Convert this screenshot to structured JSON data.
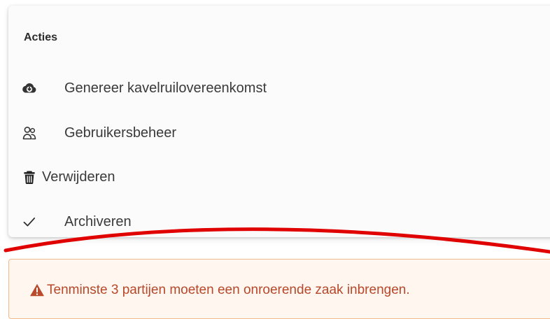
{
  "actions": {
    "title": "Acties",
    "items": [
      {
        "label": "Genereer kavelruilovereenkomst",
        "icon": "cloud-download-icon"
      },
      {
        "label": "Gebruikersbeheer",
        "icon": "users-icon"
      },
      {
        "label": "Verwijderen",
        "icon": "trash-icon"
      },
      {
        "label": "Archiveren",
        "icon": "check-icon"
      }
    ]
  },
  "alert": {
    "message": "Tenminste 3 partijen moeten een onroerende zaak inbrengen.",
    "icon": "warning-icon"
  },
  "colors": {
    "alert_text": "#b7472a",
    "alert_border": "#f2b98d",
    "alert_background": "#fff7ef",
    "annotation": "#e00000"
  }
}
